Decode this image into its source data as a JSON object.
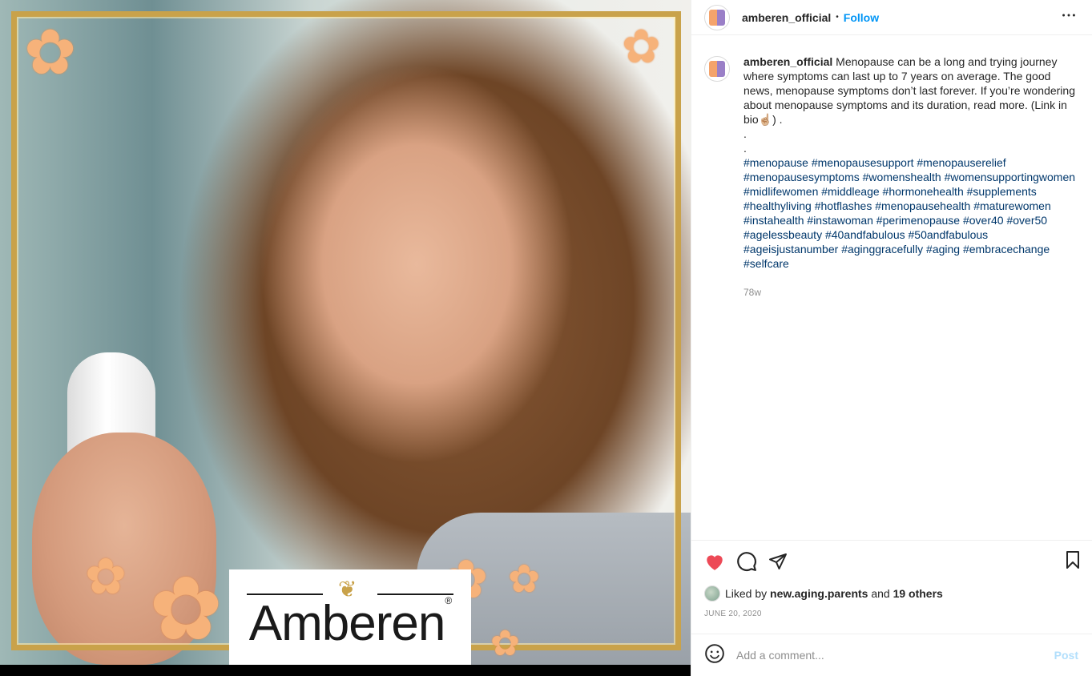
{
  "header": {
    "username": "amberen_official",
    "separator": "•",
    "follow_label": "Follow",
    "more_icon": "more-horizontal-icon"
  },
  "media": {
    "logo_text": "Amberen",
    "logo_reg": "®"
  },
  "caption": {
    "username": "amberen_official",
    "text": "Menopause can be a long and trying journey where symptoms can last up to 7 years on average. The good news, menopause symptoms don’t last forever. If you’re wondering about menopause symptoms and its duration, read more. (Link in bio☝🏼) .",
    "dot1": ".",
    "dot2": ".",
    "hashtags": [
      "#menopause",
      "#menopausesupport",
      "#menopauserelief",
      "#menopausesymptoms",
      "#womenshealth",
      "#womensupportingwomen",
      "#midlifewomen",
      "#middleage",
      "#hormonehealth",
      "#supplements",
      "#healthyliving",
      "#hotflashes",
      "#menopausehealth",
      "#maturewomen",
      "#instahealth",
      "#instawoman",
      "#perimenopause",
      "#over40",
      "#over50",
      "#agelessbeauty",
      "#40andfabulous",
      "#50andfabulous",
      "#ageisjustanumber",
      "#aginggracefully",
      "#aging",
      "#embracechange",
      "#selfcare"
    ],
    "time_ago": "78w"
  },
  "actions": {
    "like_icon": "heart-filled-icon",
    "comment_icon": "comment-icon",
    "share_icon": "share-icon",
    "save_icon": "bookmark-icon",
    "like_color": "#ed4956"
  },
  "likes": {
    "prefix": "Liked by",
    "user": "new.aging.parents",
    "and": "and",
    "others": "19 others"
  },
  "date": "JUNE 20, 2020",
  "comment": {
    "placeholder": "Add a comment...",
    "post_label": "Post",
    "emoji_icon": "emoji-icon"
  }
}
